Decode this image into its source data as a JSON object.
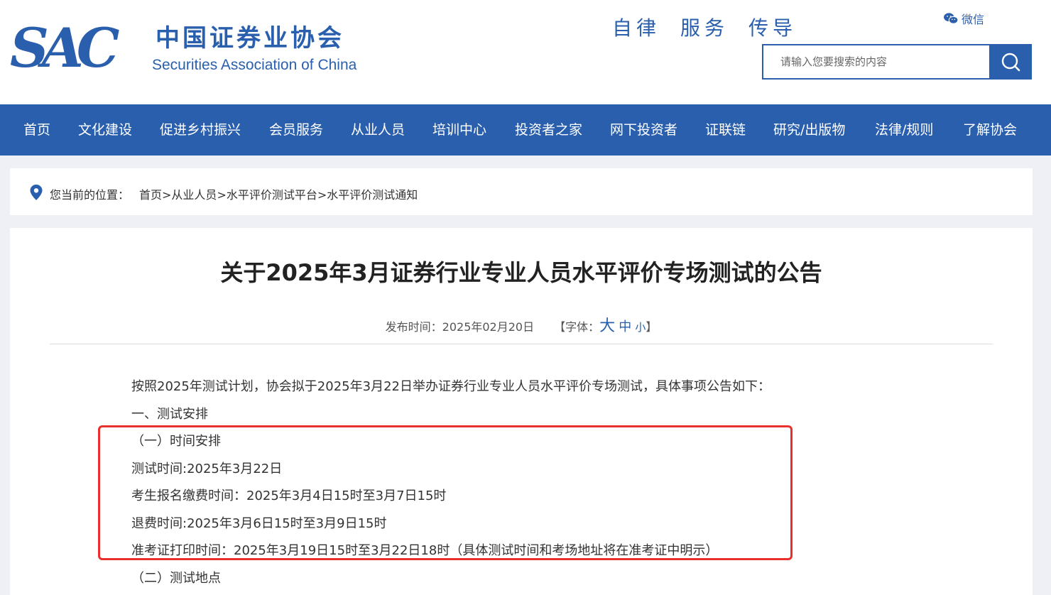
{
  "header": {
    "logo_mark": "SAC",
    "logo_cn": "中国证券业协会",
    "logo_en": "Securities Association of China",
    "slogan": [
      "自律",
      "服务",
      "传导"
    ],
    "wechat_label": "微信",
    "search_placeholder": "请输入您要搜索的内容"
  },
  "nav": {
    "items": [
      "首页",
      "文化建设",
      "促进乡村振兴",
      "会员服务",
      "从业人员",
      "培训中心",
      "投资者之家",
      "网下投资者",
      "证联链",
      "研究/出版物",
      "法律/规则",
      "了解协会"
    ]
  },
  "breadcrumb": {
    "label": "您当前的位置：",
    "items": [
      "首页",
      "从业人员",
      "水平评价测试平台",
      "水平评价测试通知"
    ],
    "separator": ">"
  },
  "article": {
    "title": "关于2025年3月证券行业专业人员水平评价专场测试的公告",
    "publish_label": "发布时间：",
    "publish_date": "2025年02月20日",
    "font_size_open": "【字体：",
    "font_big": "大",
    "font_mid": "中",
    "font_small": "小",
    "font_size_close": "】",
    "paragraphs": [
      "按照2025年测试计划，协会拟于2025年3月22日举办证券行业专业人员水平评价专场测试，具体事项公告如下：",
      "一、测试安排",
      "（一）时间安排",
      "测试时间:2025年3月22日",
      "考生报名缴费时间：2025年3月4日15时至3月7日15时",
      "退费时间:2025年3月6日15时至3月9日15时",
      "准考证打印时间：2025年3月19日15时至3月22日18时（具体测试时间和考场地址将在准考证中明示）",
      "（二）测试地点"
    ]
  },
  "colors": {
    "brand_blue": "#2a5fae",
    "highlight_red": "#e8302c",
    "page_bg": "#eef0f5"
  }
}
